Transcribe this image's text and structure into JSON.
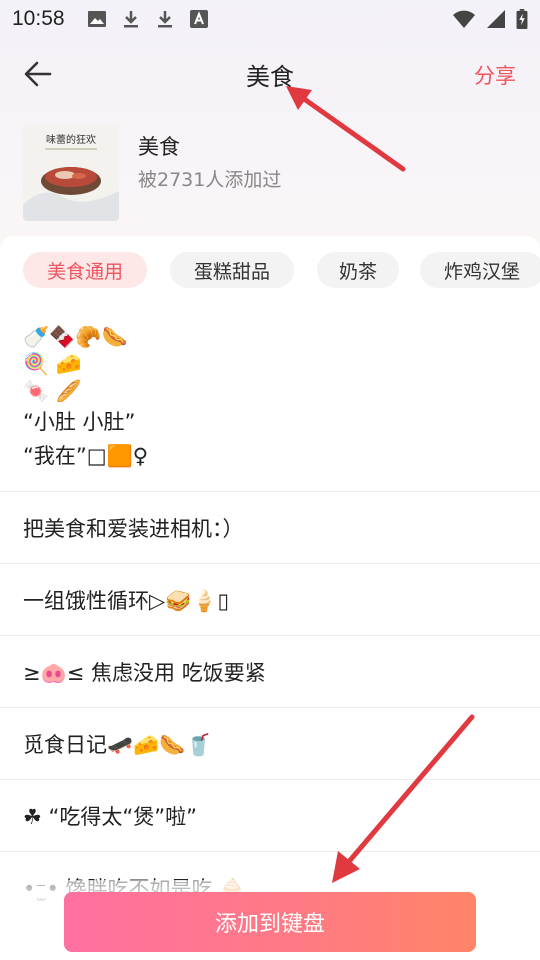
{
  "status": {
    "time": "10:58"
  },
  "header": {
    "title": "美食",
    "share": "分享"
  },
  "info": {
    "title": "美食",
    "subtitle": "被2731人添加过",
    "thumb_text": "味蕾的狂欢"
  },
  "tags": [
    "美食通用",
    "蛋糕甜品",
    "奶茶",
    "炸鸡汉堡"
  ],
  "items": [
    {
      "lines": [
        "🍼🍫🥐🌭",
        "🍭 🧀",
        "🍬 🥖",
        "“小肚 小肚”",
        "“我在”□🟧♀"
      ]
    },
    {
      "lines": [
        "把美食和爱装进相机：）"
      ]
    },
    {
      "lines": [
        "一组饿性循环▷🥪🍦▯"
      ]
    },
    {
      "lines": [
        "≥🐽≤ 焦虑没用 吃饭要紧"
      ]
    },
    {
      "lines": [
        "觅食日记🛹🧀🌭🥤"
      ]
    },
    {
      "lines": [
        "☘ “吃得太“煲”啦”"
      ]
    },
    {
      "lines": [
        "•⁻̫• 馋胖吃不如是吃 🧁"
      ]
    }
  ],
  "bottom": {
    "add_label": "添加到键盘"
  },
  "colors": {
    "accent": "#f0555f",
    "button_start": "#ff6fa0",
    "button_end": "#ff8467",
    "annotation_arrow": "#e0393f"
  },
  "icons": [
    "back-arrow-icon",
    "image-icon",
    "download-icon",
    "text-icon",
    "wifi-icon",
    "signal-icon",
    "battery-charging-icon"
  ]
}
